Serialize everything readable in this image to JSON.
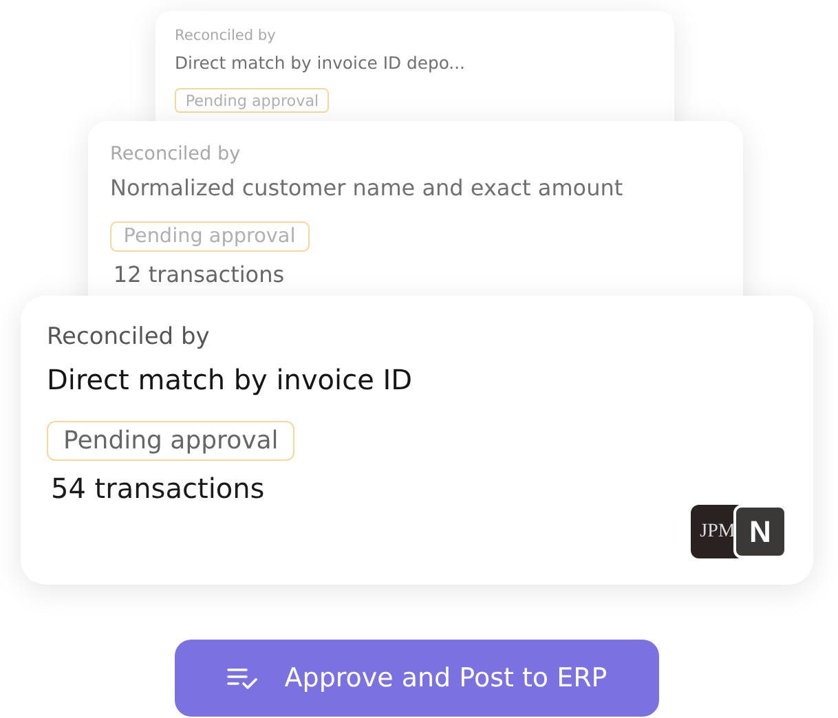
{
  "cards": [
    {
      "label": "Reconciled by",
      "method": "Direct match by invoice ID depo...",
      "status": "Pending approval"
    },
    {
      "label": "Reconciled by",
      "method": "Normalized customer name and exact amount",
      "status": "Pending approval",
      "count": "12 transactions"
    },
    {
      "label": "Reconciled by",
      "method": "Direct match by invoice ID",
      "status": "Pending approval",
      "count": "54 transactions",
      "logos": [
        {
          "text": "JPM",
          "kind": "bank"
        },
        {
          "text": "N",
          "kind": "app"
        }
      ]
    }
  ],
  "action": {
    "label": "Approve and Post to ERP"
  }
}
